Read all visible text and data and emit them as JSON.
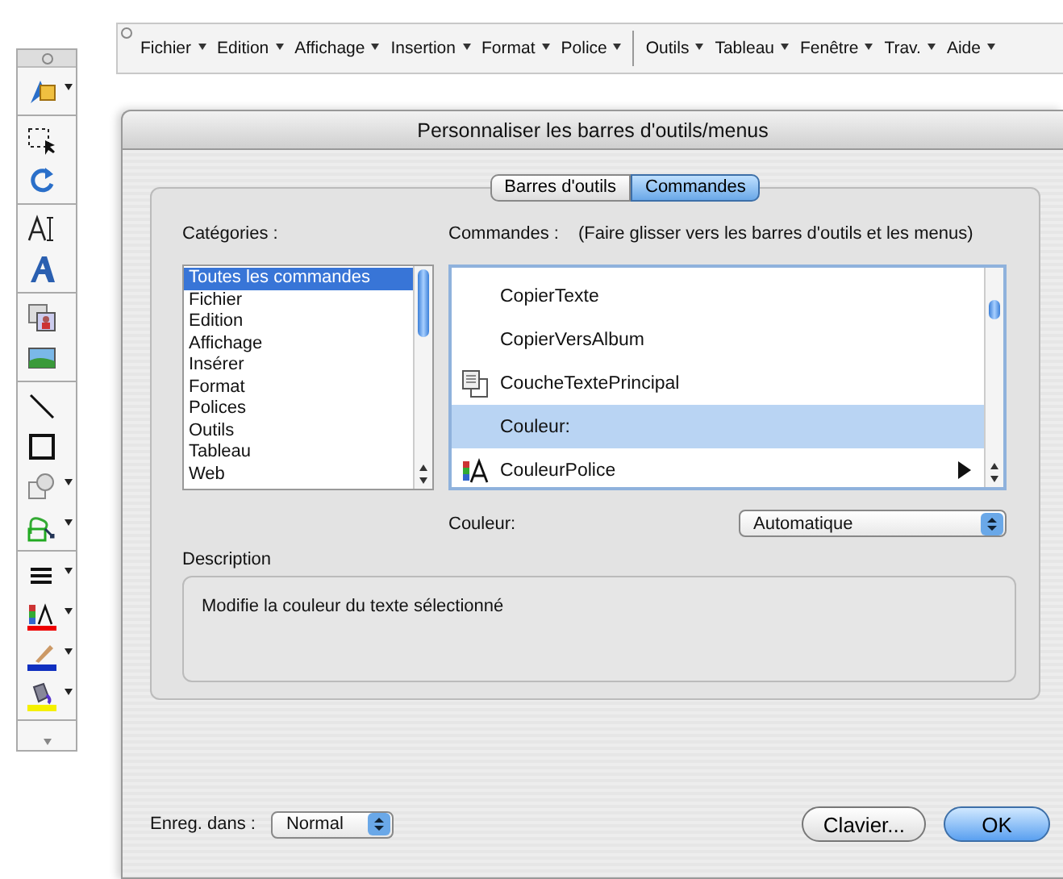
{
  "palette": {
    "groups": [
      {
        "tools": [
          {
            "kind": "gallery",
            "dropdown": true
          }
        ]
      },
      {
        "tools": [
          {
            "kind": "marquee",
            "dropdown": false
          },
          {
            "kind": "rotate",
            "dropdown": false
          }
        ]
      },
      {
        "tools": [
          {
            "kind": "textbox",
            "dropdown": false
          },
          {
            "kind": "wordart",
            "dropdown": false
          }
        ]
      },
      {
        "tools": [
          {
            "kind": "clipart",
            "dropdown": false
          },
          {
            "kind": "image",
            "dropdown": false
          }
        ]
      },
      {
        "tools": [
          {
            "kind": "line",
            "dropdown": false
          },
          {
            "kind": "rectangle",
            "dropdown": false
          },
          {
            "kind": "shapes",
            "dropdown": true
          },
          {
            "kind": "connector",
            "dropdown": true
          }
        ]
      },
      {
        "tools": [
          {
            "kind": "line-style",
            "dropdown": true
          },
          {
            "kind": "font-color",
            "dropdown": true
          },
          {
            "kind": "line-color",
            "dropdown": true
          },
          {
            "kind": "fill-color",
            "dropdown": true
          }
        ]
      }
    ]
  },
  "menubar": {
    "groups": [
      {
        "items": [
          "Fichier",
          "Edition",
          "Affichage",
          "Insertion",
          "Format",
          "Police"
        ]
      },
      {
        "items": [
          "Outils",
          "Tableau",
          "Fenêtre",
          "Trav.",
          "Aide"
        ]
      }
    ]
  },
  "dialog": {
    "title": "Personnaliser les barres d'outils/menus",
    "tabs": [
      {
        "label": "Barres d'outils",
        "selected": false
      },
      {
        "label": "Commandes",
        "selected": true
      }
    ],
    "categories": {
      "label": "Catégories :",
      "items": [
        {
          "label": "Toutes les commandes",
          "selected": true
        },
        {
          "label": "Fichier",
          "selected": false
        },
        {
          "label": "Edition",
          "selected": false
        },
        {
          "label": "Affichage",
          "selected": false
        },
        {
          "label": "Insérer",
          "selected": false
        },
        {
          "label": "Format",
          "selected": false
        },
        {
          "label": "Polices",
          "selected": false
        },
        {
          "label": "Outils",
          "selected": false
        },
        {
          "label": "Tableau",
          "selected": false
        },
        {
          "label": "Web",
          "selected": false
        }
      ]
    },
    "commands": {
      "label": "Commandes :",
      "hint": "(Faire glisser vers les barres d'outils et les menus)",
      "items": [
        {
          "label": "CopierTexte",
          "selected": false,
          "submenu": false
        },
        {
          "label": "CopierVersAlbum",
          "selected": false,
          "submenu": false
        },
        {
          "label": "CoucheTextePrincipal",
          "kind": "pages",
          "selected": false,
          "submenu": false
        },
        {
          "label": "Couleur:",
          "selected": true,
          "submenu": false
        },
        {
          "label": "CouleurPolice",
          "kind": "font-color",
          "selected": false,
          "submenu": true
        }
      ]
    },
    "color": {
      "label": "Couleur:",
      "value": "Automatique"
    },
    "description": {
      "label": "Description",
      "text": "Modifie la couleur du texte sélectionné"
    },
    "save_in": {
      "label": "Enreg. dans :",
      "value": "Normal"
    },
    "buttons": [
      {
        "label": "Clavier...",
        "default": false
      },
      {
        "label": "OK",
        "default": true
      }
    ]
  }
}
